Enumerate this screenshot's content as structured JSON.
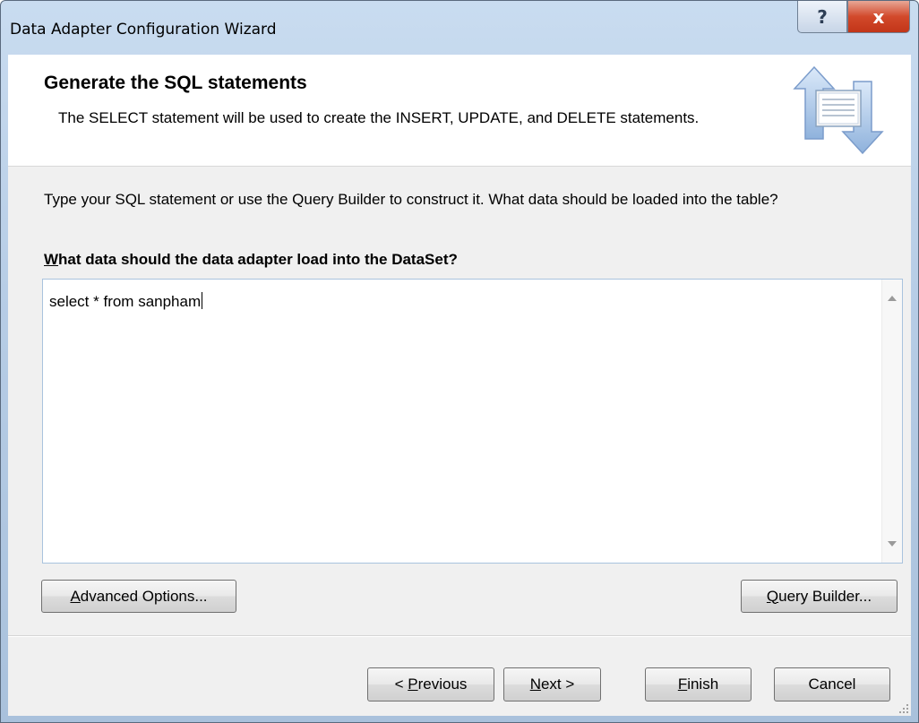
{
  "window": {
    "title": "Data Adapter Configuration Wizard",
    "help_glyph": "?",
    "close_glyph": "x"
  },
  "header": {
    "title": "Generate the SQL statements",
    "description": "The SELECT statement will be used to create the INSERT, UPDATE, and DELETE statements."
  },
  "body": {
    "instructions": "Type your SQL statement or use the Query Builder to construct it. What data should be loaded into the table?",
    "question_accesskey": "W",
    "question_rest": "hat data should the data adapter load into the DataSet?",
    "sql_text": "select * from sanpham"
  },
  "buttons": {
    "advanced": {
      "accesskey": "A",
      "rest": "dvanced Options..."
    },
    "query_builder": {
      "accesskey": "Q",
      "rest": "uery Builder..."
    },
    "previous": {
      "prefix": "< ",
      "accesskey": "P",
      "rest": "revious"
    },
    "next": {
      "accesskey": "N",
      "rest": "ext >"
    },
    "finish": {
      "accesskey": "F",
      "rest": "inish"
    },
    "cancel": {
      "label": "Cancel"
    }
  },
  "icons": {
    "wizard": "data-adapter-arrows-icon",
    "help": "help-icon",
    "close": "close-icon",
    "scroll_up": "scroll-up-arrow-icon",
    "scroll_down": "scroll-down-arrow-icon",
    "resize": "resize-grip-icon"
  },
  "colors": {
    "title_bar": "#b7cde6",
    "close_button": "#c9462b",
    "header_background": "#ffffff",
    "dialog_background": "#f0f0f0",
    "textbox_border": "#a9c3de"
  }
}
